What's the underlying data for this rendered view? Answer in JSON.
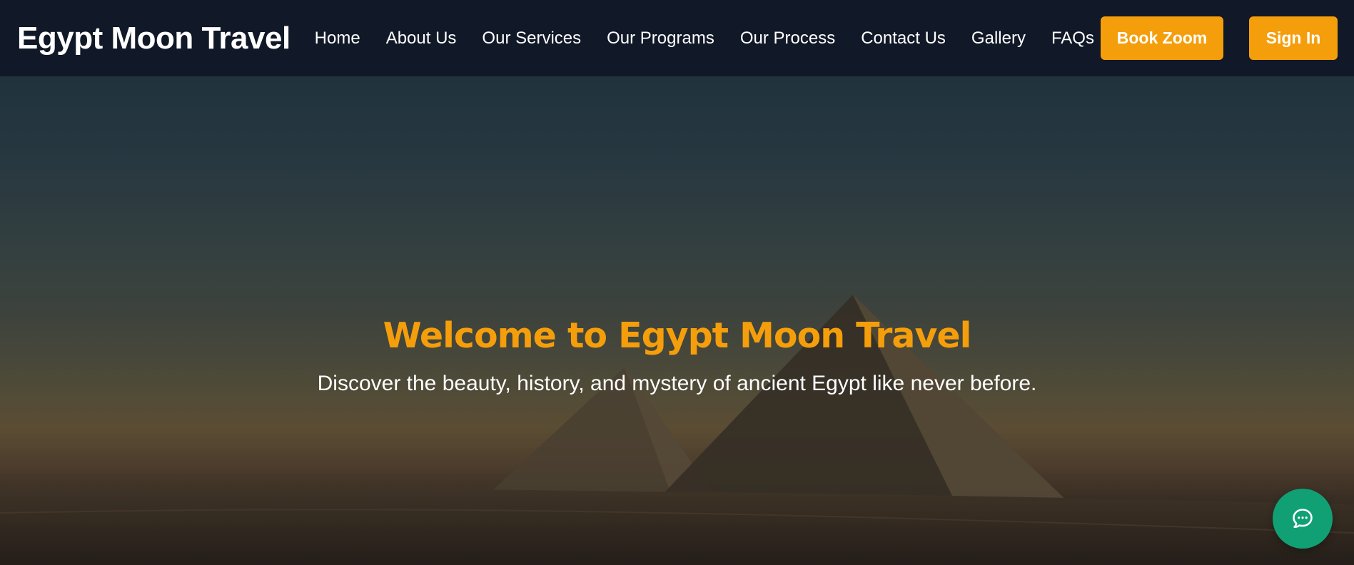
{
  "navbar": {
    "brand": "Egypt Moon Travel",
    "links": [
      "Home",
      "About Us",
      "Our Services",
      "Our Programs",
      "Our Process",
      "Contact Us",
      "Gallery",
      "FAQs"
    ],
    "book_zoom_label": "Book Zoom",
    "sign_in_label": "Sign In"
  },
  "hero": {
    "title": "Welcome to Egypt Moon Travel",
    "subtitle": "Discover the beauty, history, and mystery of ancient Egypt like never before."
  },
  "chat": {
    "icon": "chat-bubble-icon"
  },
  "colors": {
    "navbar_bg": "#111827",
    "accent": "#f59e0b",
    "chat_button": "#10a074",
    "text": "#ffffff"
  }
}
